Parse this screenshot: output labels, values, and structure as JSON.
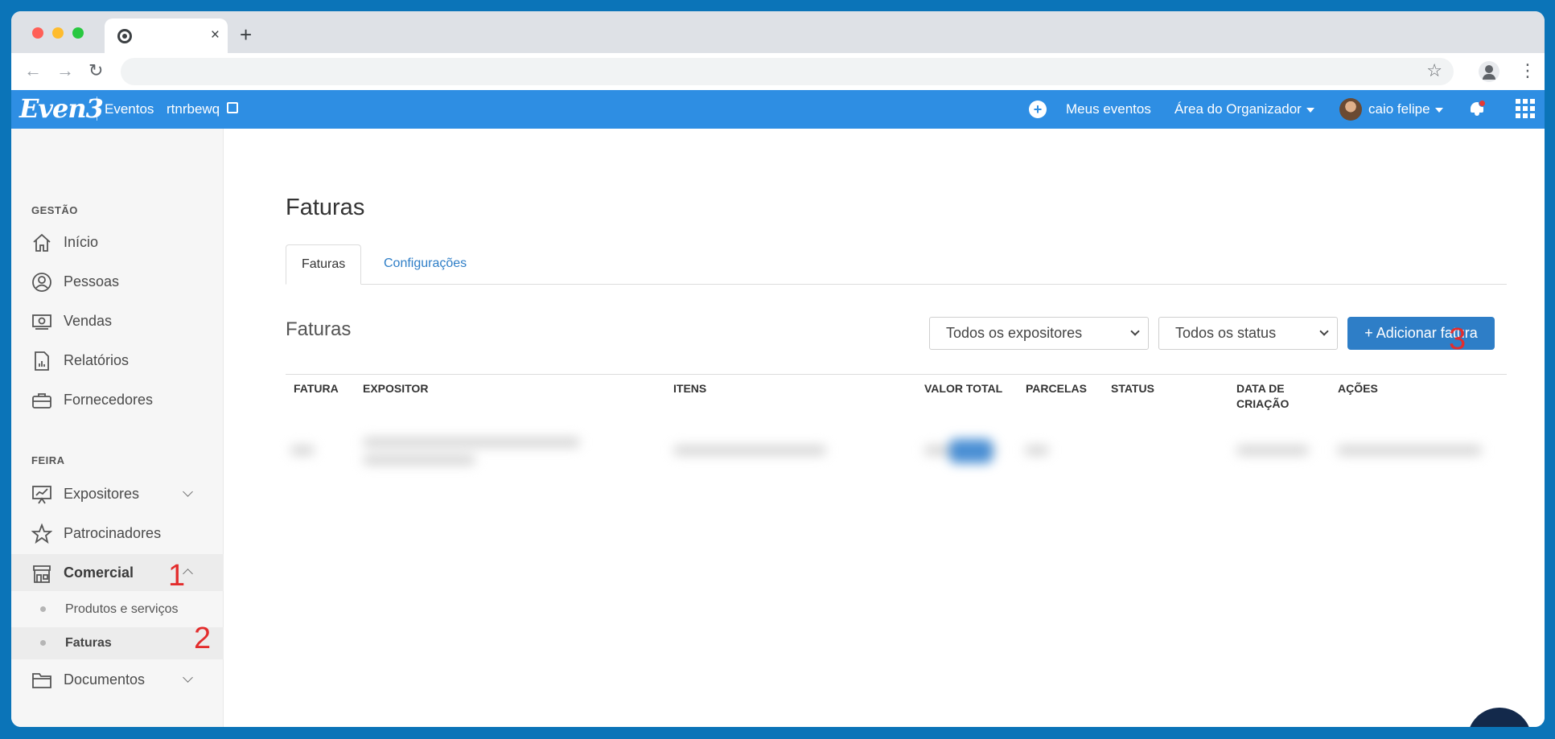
{
  "browser": {
    "tab_close": "×",
    "new_tab": "+",
    "back": "←",
    "forward": "→",
    "reload": "↻",
    "bookmark_star": "☆",
    "menu": "⋮"
  },
  "header": {
    "logo": "Even3",
    "eventos": "Eventos",
    "event_name": "rtnrbewq",
    "add": "+",
    "meus_eventos": "Meus eventos",
    "area_organizador": "Área do Organizador",
    "user_name": "caio felipe"
  },
  "sidebar": {
    "section_gestao": "GESTÃO",
    "section_feira": "FEIRA",
    "items": [
      {
        "label": "Início"
      },
      {
        "label": "Pessoas"
      },
      {
        "label": "Vendas"
      },
      {
        "label": "Relatórios"
      },
      {
        "label": "Fornecedores"
      },
      {
        "label": "Expositores"
      },
      {
        "label": "Patrocinadores"
      },
      {
        "label": "Comercial"
      },
      {
        "label": "Documentos"
      }
    ],
    "subitems": [
      {
        "label": "Produtos e serviços"
      },
      {
        "label": "Faturas"
      }
    ]
  },
  "main": {
    "page_title": "Faturas",
    "tabs": [
      {
        "label": "Faturas"
      },
      {
        "label": "Configurações"
      }
    ],
    "section_title": "Faturas",
    "filter_expositores": "Todos os expositores",
    "filter_status": "Todos os status",
    "add_button": "+ Adicionar fatura",
    "table": {
      "headers": [
        "FATURA",
        "EXPOSITOR",
        "ITENS",
        "VALOR TOTAL",
        "PARCELAS",
        "STATUS",
        "DATA DE CRIAÇÃO",
        "AÇÕES"
      ]
    }
  },
  "annotations": [
    "1",
    "2",
    "3"
  ],
  "colors": {
    "app_header": "#2e8ee3",
    "primary_button": "#2e7ec7",
    "annotation": "#e32d2d"
  }
}
